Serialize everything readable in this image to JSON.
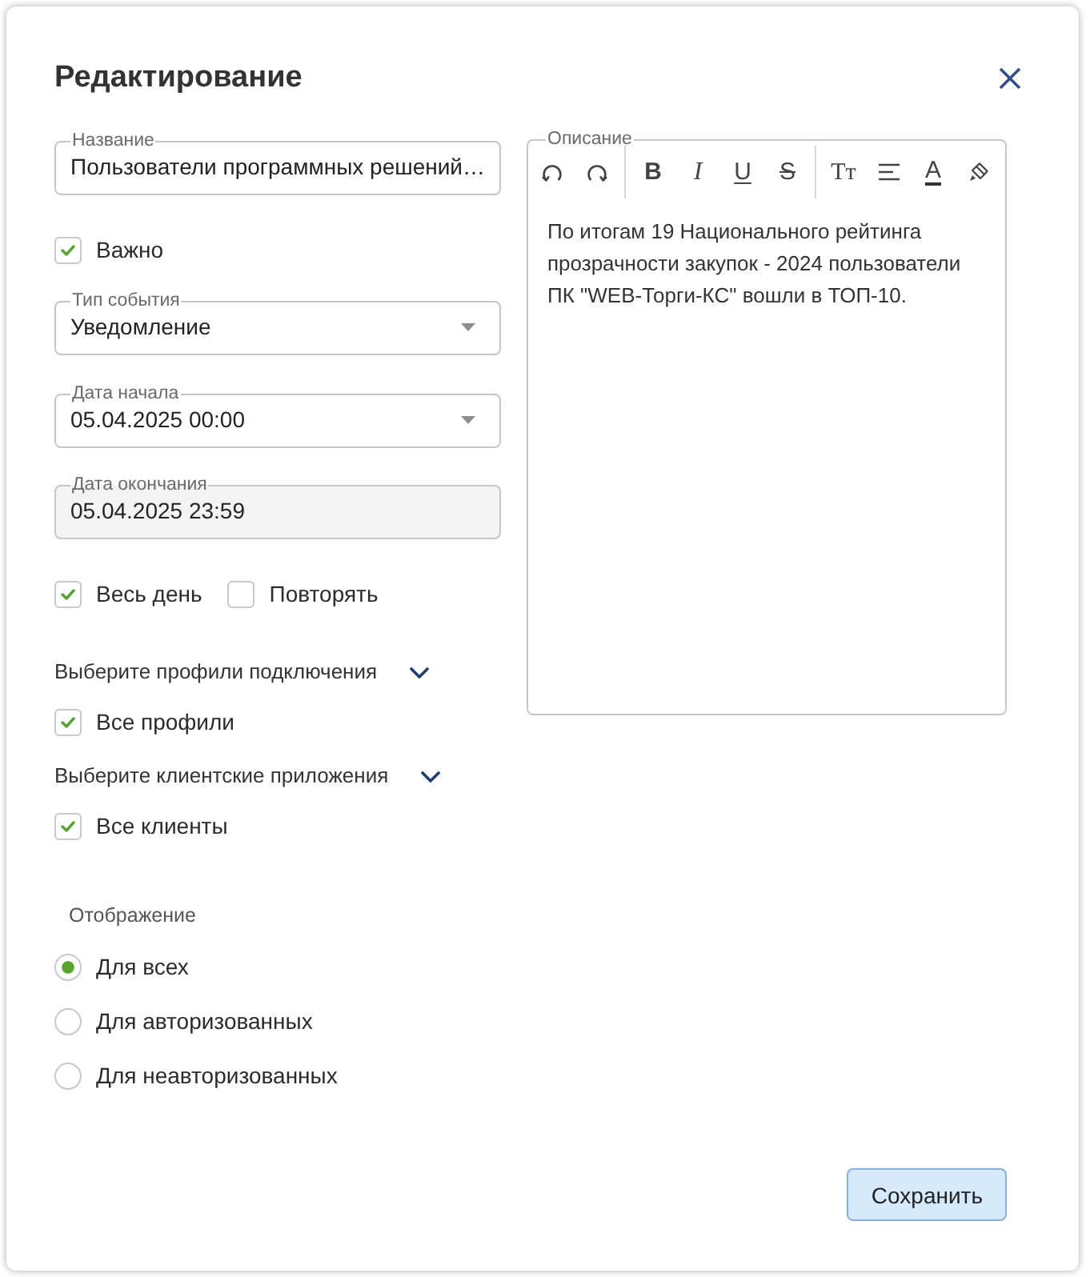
{
  "dialog": {
    "title": "Редактирование"
  },
  "form": [
    {
      "kind": "text",
      "label": "Название",
      "value": "Пользователи программных решений…",
      "disabled": false
    },
    {
      "kind": "checkboxes",
      "items": [
        {
          "label": "Важно",
          "checked": true
        }
      ]
    },
    {
      "kind": "select",
      "label": "Тип события",
      "value": "Уведомление",
      "disabled": false
    },
    {
      "kind": "select",
      "label": "Дата начала",
      "value": "05.04.2025 00:00",
      "disabled": false
    },
    {
      "kind": "text",
      "label": "Дата окончания",
      "value": "05.04.2025 23:59",
      "disabled": true
    },
    {
      "kind": "checkboxes",
      "items": [
        {
          "label": "Весь день",
          "checked": true
        },
        {
          "label": "Повторять",
          "checked": false
        }
      ]
    },
    {
      "kind": "filter",
      "label": "Выберите профили подключения",
      "expanded": false,
      "option": {
        "label": "Все профили",
        "checked": true
      }
    },
    {
      "kind": "filter",
      "label": "Выберите клиентские приложения",
      "expanded": false,
      "option": {
        "label": "Все клиенты",
        "checked": true
      }
    },
    {
      "kind": "radio_group",
      "label": "Отображение",
      "options": [
        {
          "label": "Для всех",
          "selected": true
        },
        {
          "label": "Для авторизованных",
          "selected": false
        },
        {
          "label": "Для неавторизованных",
          "selected": false
        }
      ]
    }
  ],
  "description": {
    "label": "Описание",
    "toolbar": [
      [
        {
          "kind": "undo"
        },
        {
          "kind": "redo"
        }
      ],
      [
        {
          "kind": "bold",
          "glyph": "B"
        },
        {
          "kind": "italic",
          "glyph": "I"
        },
        {
          "kind": "underline",
          "glyph": "U"
        },
        {
          "kind": "strikethrough",
          "glyph": "S"
        }
      ],
      [
        {
          "kind": "font_size",
          "glyph": "Tт"
        },
        {
          "kind": "align"
        },
        {
          "kind": "font_color",
          "glyph": "A"
        },
        {
          "kind": "highlight"
        }
      ]
    ],
    "text": "По итогам 19 Национального рейтинга прозрачности закупок - 2024 пользователи ПК \"WEB-Торги-КС\" вошли в ТОП-10."
  },
  "buttons": [
    {
      "label": "Сохранить"
    }
  ]
}
